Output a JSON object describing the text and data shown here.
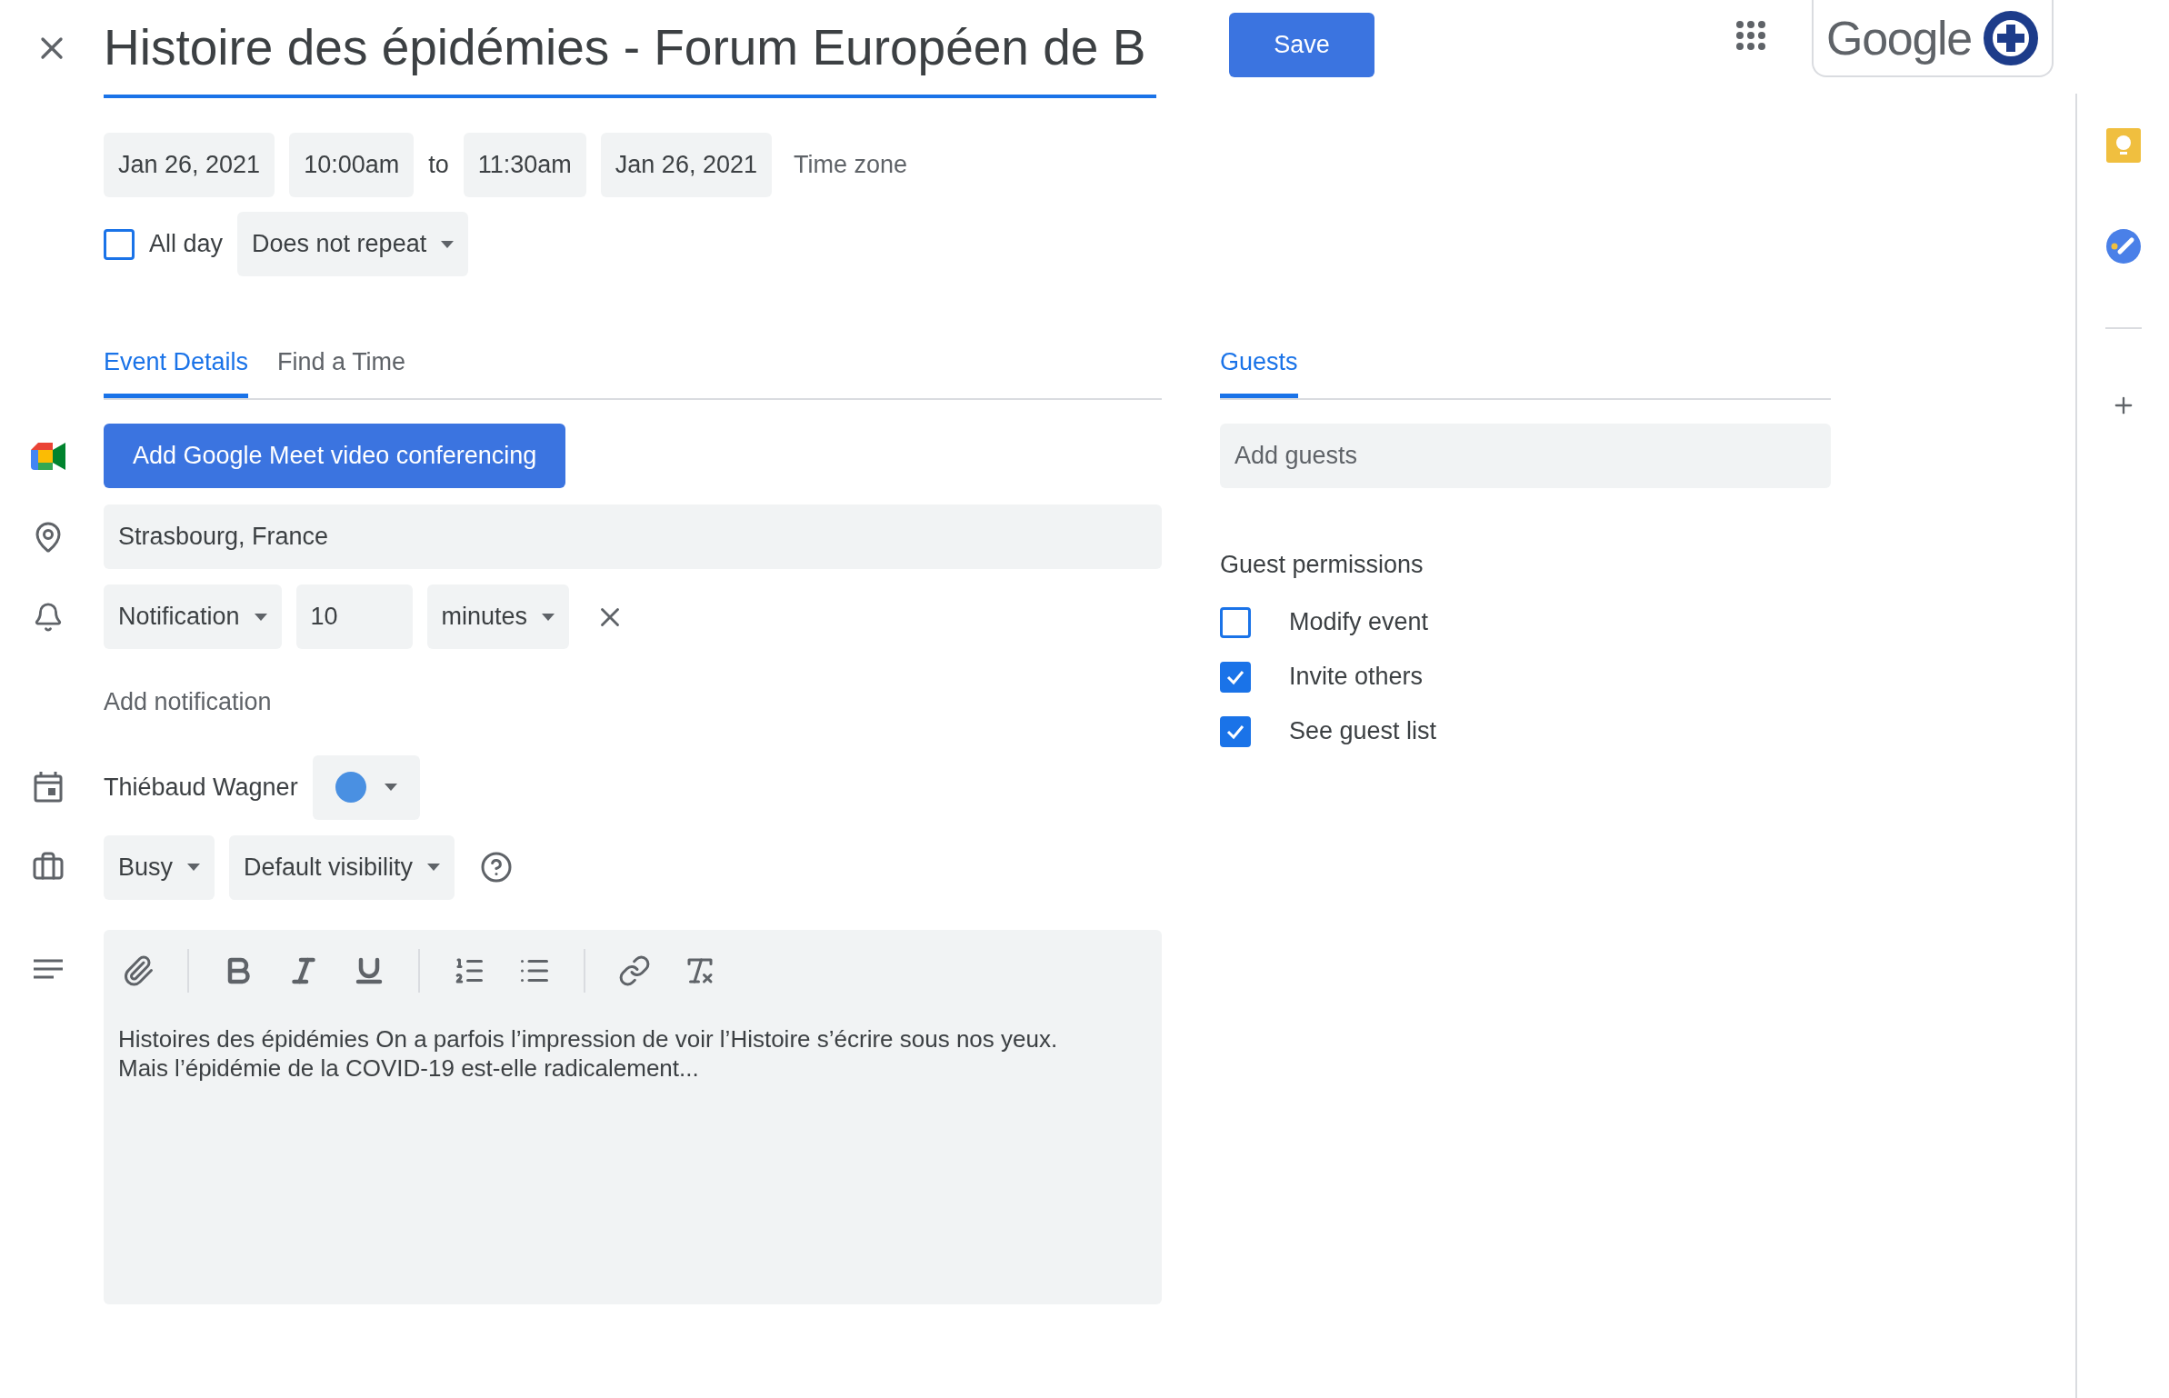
{
  "title": "Histoire des épidémies - Forum Européen de B",
  "save_button": "Save",
  "logo": "Google",
  "date_row": {
    "start_date": "Jan 26, 2021",
    "start_time": "10:00am",
    "separator": "to",
    "end_time": "11:30am",
    "end_date": "Jan 26, 2021",
    "time_zone": "Time zone"
  },
  "all_day": {
    "label": "All day",
    "checked": false
  },
  "repeat": "Does not repeat",
  "tabs": [
    {
      "label": "Event Details",
      "selected": true
    },
    {
      "label": "Find a Time",
      "selected": false
    }
  ],
  "meet_button": "Add Google Meet video conferencing",
  "location": "Strasbourg, France",
  "notification": {
    "type": "Notification",
    "value": "10",
    "unit": "minutes"
  },
  "add_notification": "Add notification",
  "calendar": {
    "owner": "Thiébaud Wagner",
    "color": "#4a90e2"
  },
  "availability": "Busy",
  "visibility": "Default visibility",
  "description": "Histoires des épidémies On a parfois l’impression de voir l’Histoire s’écrire sous nos yeux.\nMais l’épidémie de la COVID-19 est-elle radicalement...",
  "guests": {
    "tabs": [
      {
        "label": "Guests",
        "selected": true
      }
    ],
    "placeholder": "Add guests",
    "permissions_title": "Guest permissions",
    "permissions": [
      {
        "label": "Modify event",
        "checked": false
      },
      {
        "label": "Invite others",
        "checked": true
      },
      {
        "label": "See guest list",
        "checked": true
      }
    ]
  }
}
